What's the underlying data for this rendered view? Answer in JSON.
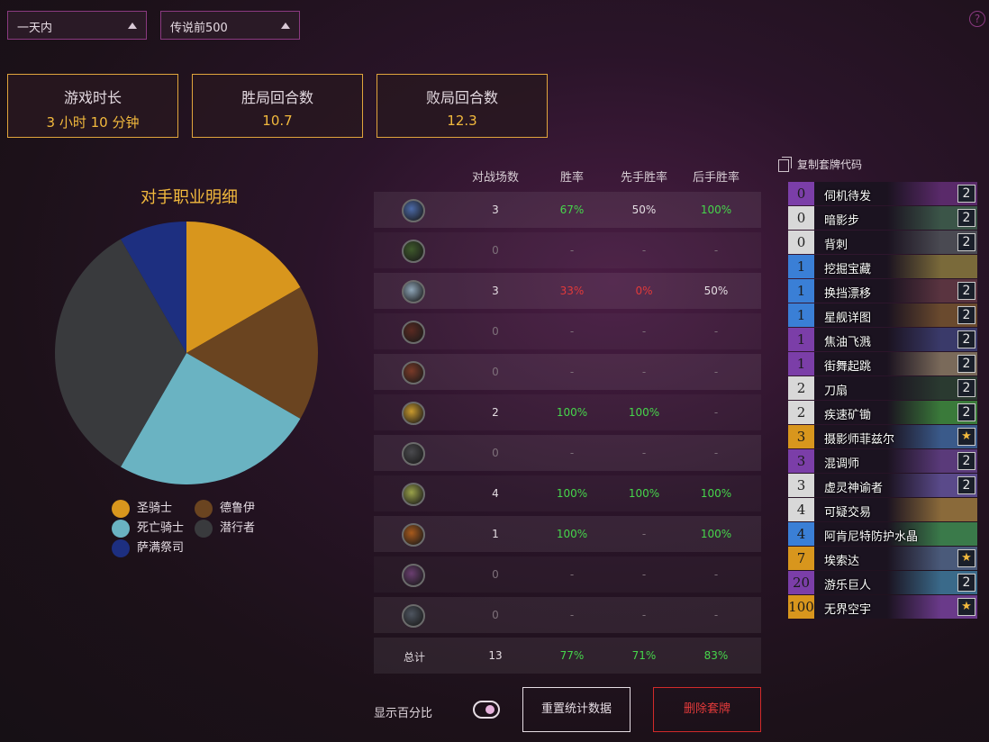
{
  "filters": {
    "time": "一天内",
    "rank": "传说前500",
    "help": "?"
  },
  "stats": [
    {
      "label": "游戏时长",
      "value": "3 小时 10 分钟"
    },
    {
      "label": "胜局回合数",
      "value": "10.7"
    },
    {
      "label": "败局回合数",
      "value": "12.3"
    }
  ],
  "pie": {
    "title": "对手职业明细",
    "legend": [
      {
        "label": "圣骑士",
        "color": "#d8961d"
      },
      {
        "label": "德鲁伊",
        "color": "#6a4420"
      },
      {
        "label": "死亡骑士",
        "color": "#6ab3c2"
      },
      {
        "label": "潜行者",
        "color": "#393a3d"
      },
      {
        "label": "萨满祭司",
        "color": "#1d2f80"
      }
    ]
  },
  "chart_data": {
    "type": "pie",
    "title": "对手职业明细",
    "categories": [
      "圣骑士",
      "德鲁伊",
      "死亡骑士",
      "潜行者",
      "萨满祭司"
    ],
    "values": [
      2,
      2,
      3,
      4,
      1
    ],
    "colors": [
      "#d8961d",
      "#6a4420",
      "#6ab3c2",
      "#393a3d",
      "#1d2f80"
    ],
    "legend": "bottom"
  },
  "table": {
    "headers": [
      "对战场数",
      "胜率",
      "先手胜率",
      "后手胜率"
    ],
    "rows": [
      {
        "icon": "death-knight-icon",
        "color": "#4c6aa8",
        "games": "3",
        "wr": "67%",
        "wrc": "green",
        "first": "50%",
        "firstc": "white",
        "second": "100%",
        "secondc": "green"
      },
      {
        "icon": "demon-hunter-icon",
        "color": "#3f5a2c",
        "games": "0",
        "wr": "-",
        "wrc": "dim",
        "first": "-",
        "firstc": "dim",
        "second": "-",
        "secondc": "dim"
      },
      {
        "icon": "druid-icon",
        "color": "#8fa6b8",
        "games": "3",
        "wr": "33%",
        "wrc": "red",
        "first": "0%",
        "firstc": "red",
        "second": "50%",
        "secondc": "white"
      },
      {
        "icon": "hunter-icon",
        "color": "#5a2a22",
        "games": "0",
        "wr": "-",
        "wrc": "dim",
        "first": "-",
        "firstc": "dim",
        "second": "-",
        "secondc": "dim"
      },
      {
        "icon": "mage-icon",
        "color": "#7a3a28",
        "games": "0",
        "wr": "-",
        "wrc": "dim",
        "first": "-",
        "firstc": "dim",
        "second": "-",
        "secondc": "dim"
      },
      {
        "icon": "paladin-icon",
        "color": "#c99a2e",
        "games": "2",
        "wr": "100%",
        "wrc": "green",
        "first": "100%",
        "firstc": "green",
        "second": "-",
        "secondc": "dim"
      },
      {
        "icon": "priest-icon",
        "color": "#4a4a4e",
        "games": "0",
        "wr": "-",
        "wrc": "dim",
        "first": "-",
        "firstc": "dim",
        "second": "-",
        "secondc": "dim"
      },
      {
        "icon": "rogue-icon",
        "color": "#9aa24a",
        "games": "4",
        "wr": "100%",
        "wrc": "green",
        "first": "100%",
        "firstc": "green",
        "second": "100%",
        "secondc": "green"
      },
      {
        "icon": "shaman-icon",
        "color": "#a85a1c",
        "games": "1",
        "wr": "100%",
        "wrc": "green",
        "first": "-",
        "firstc": "dim",
        "second": "100%",
        "secondc": "green"
      },
      {
        "icon": "warlock-icon",
        "color": "#6a3e70",
        "games": "0",
        "wr": "-",
        "wrc": "dim",
        "first": "-",
        "firstc": "dim",
        "second": "-",
        "secondc": "dim"
      },
      {
        "icon": "warrior-icon",
        "color": "#4e5560",
        "games": "0",
        "wr": "-",
        "wrc": "dim",
        "first": "-",
        "firstc": "dim",
        "second": "-",
        "secondc": "dim"
      }
    ],
    "total": {
      "label": "总计",
      "games": "13",
      "wr": "77%",
      "first": "71%",
      "second": "83%"
    }
  },
  "deck": {
    "copy_label": "复制套牌代码",
    "cards": [
      {
        "cost": "0",
        "name": "伺机待发",
        "count": "2",
        "rarity": "#7b3ea8",
        "art": "#5a2a6a"
      },
      {
        "cost": "0",
        "name": "暗影步",
        "count": "2",
        "rarity": "#d8d8d8",
        "art": "#3b5548"
      },
      {
        "cost": "0",
        "name": "背刺",
        "count": "2",
        "rarity": "#d8d8d8",
        "art": "#4a4a52"
      },
      {
        "cost": "1",
        "name": "挖掘宝藏",
        "count": "",
        "rarity": "#3a7fd6",
        "art": "#7a6a3a"
      },
      {
        "cost": "1",
        "name": "换挡漂移",
        "count": "2",
        "rarity": "#3a7fd6",
        "art": "#5a3440"
      },
      {
        "cost": "1",
        "name": "星舰详图",
        "count": "2",
        "rarity": "#3a7fd6",
        "art": "#6a4a2e"
      },
      {
        "cost": "1",
        "name": "焦油飞溅",
        "count": "2",
        "rarity": "#7b3ea8",
        "art": "#3a3a6a"
      },
      {
        "cost": "1",
        "name": "街舞起跳",
        "count": "2",
        "rarity": "#7b3ea8",
        "art": "#7a6a5a"
      },
      {
        "cost": "2",
        "name": "刀扇",
        "count": "2",
        "rarity": "#d8d8d8",
        "art": "#2a3a30"
      },
      {
        "cost": "2",
        "name": "疾速矿锄",
        "count": "2",
        "rarity": "#d8d8d8",
        "art": "#3a7a3a"
      },
      {
        "cost": "3",
        "name": "摄影师菲兹尔",
        "count": "★",
        "rarity": "#d8961d",
        "art": "#3a5a8a"
      },
      {
        "cost": "3",
        "name": "混调师",
        "count": "2",
        "rarity": "#7b3ea8",
        "art": "#5a3a7a"
      },
      {
        "cost": "3",
        "name": "虚灵神谕者",
        "count": "2",
        "rarity": "#d8d8d8",
        "art": "#5a4a8a"
      },
      {
        "cost": "4",
        "name": "可疑交易",
        "count": "",
        "rarity": "#d8d8d8",
        "art": "#8a6a3a"
      },
      {
        "cost": "4",
        "name": "阿肯尼特防护水晶",
        "count": "",
        "rarity": "#3a7fd6",
        "art": "#3a7a4a"
      },
      {
        "cost": "7",
        "name": "埃索达",
        "count": "★",
        "rarity": "#d8961d",
        "art": "#4a5a7a"
      },
      {
        "cost": "20",
        "name": "游乐巨人",
        "count": "2",
        "rarity": "#7b3ea8",
        "art": "#3a6a8a"
      },
      {
        "cost": "100",
        "name": "无界空宇",
        "count": "★",
        "rarity": "#d8961d",
        "art": "#6a3a8a"
      }
    ]
  },
  "controls": {
    "show_percent": "显示百分比",
    "reset": "重置统计数据",
    "delete": "删除套牌"
  }
}
